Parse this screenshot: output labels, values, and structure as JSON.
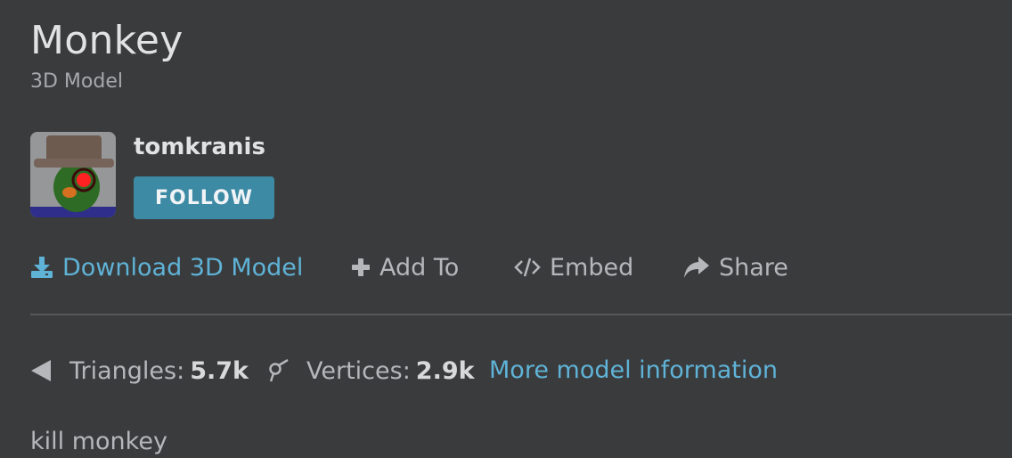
{
  "model": {
    "title": "Monkey",
    "subtitle": "3D Model"
  },
  "author": {
    "name": "tomkranis",
    "follow_label": "FOLLOW"
  },
  "actions": {
    "download_label": "Download 3D Model",
    "add_to_label": "Add To",
    "embed_label": "Embed",
    "share_label": "Share"
  },
  "stats": {
    "triangles_label": "Triangles:",
    "triangles_value": "5.7k",
    "vertices_label": "Vertices:",
    "vertices_value": "2.9k",
    "more_info_label": "More model information"
  },
  "description": "kill monkey",
  "colors": {
    "background": "#3a3b3d",
    "accent_link": "#5fb3d6",
    "follow_button": "#3d8aa5"
  },
  "icons": {
    "download": "download-icon",
    "add_to": "plus-icon",
    "embed": "code-icon",
    "share": "share-arrow-icon",
    "triangles": "triangle-icon",
    "vertices": "vertex-icon"
  }
}
